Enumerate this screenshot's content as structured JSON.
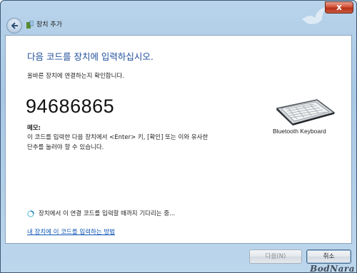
{
  "window": {
    "title": "장치 추가",
    "close_label": "x",
    "close_icon": "close-icon",
    "back_icon": "back-arrow-icon",
    "app_icon": "device-icon"
  },
  "content": {
    "heading": "다음 코드를 장치에 입력하십시오.",
    "subheading": "올바른 장치에 연결하는지 확인합니다.",
    "pairing_code": "94686865",
    "memo_title": "메모:",
    "memo_line1": "이 코드를 입력한 다음 장치에서 <Enter> 키, [확인] 또는 이와 유사한",
    "memo_line2": "단추를 눌러야 할 수 있습니다.",
    "device": {
      "name": "Bluetooth Keyboard",
      "icon": "keyboard-icon"
    },
    "waiting_text": "장치에서 이 연결 코드를 입력할 때까지 기다리는 중...",
    "help_link": "내 장치에 이 코드를 입력하는 방법"
  },
  "footer": {
    "next_label": "다음(N)",
    "cancel_label": "취소"
  },
  "watermark": "BodNara",
  "colors": {
    "heading": "#1f4f9a",
    "link": "#0d55b5",
    "close_button": "#c93c22"
  }
}
